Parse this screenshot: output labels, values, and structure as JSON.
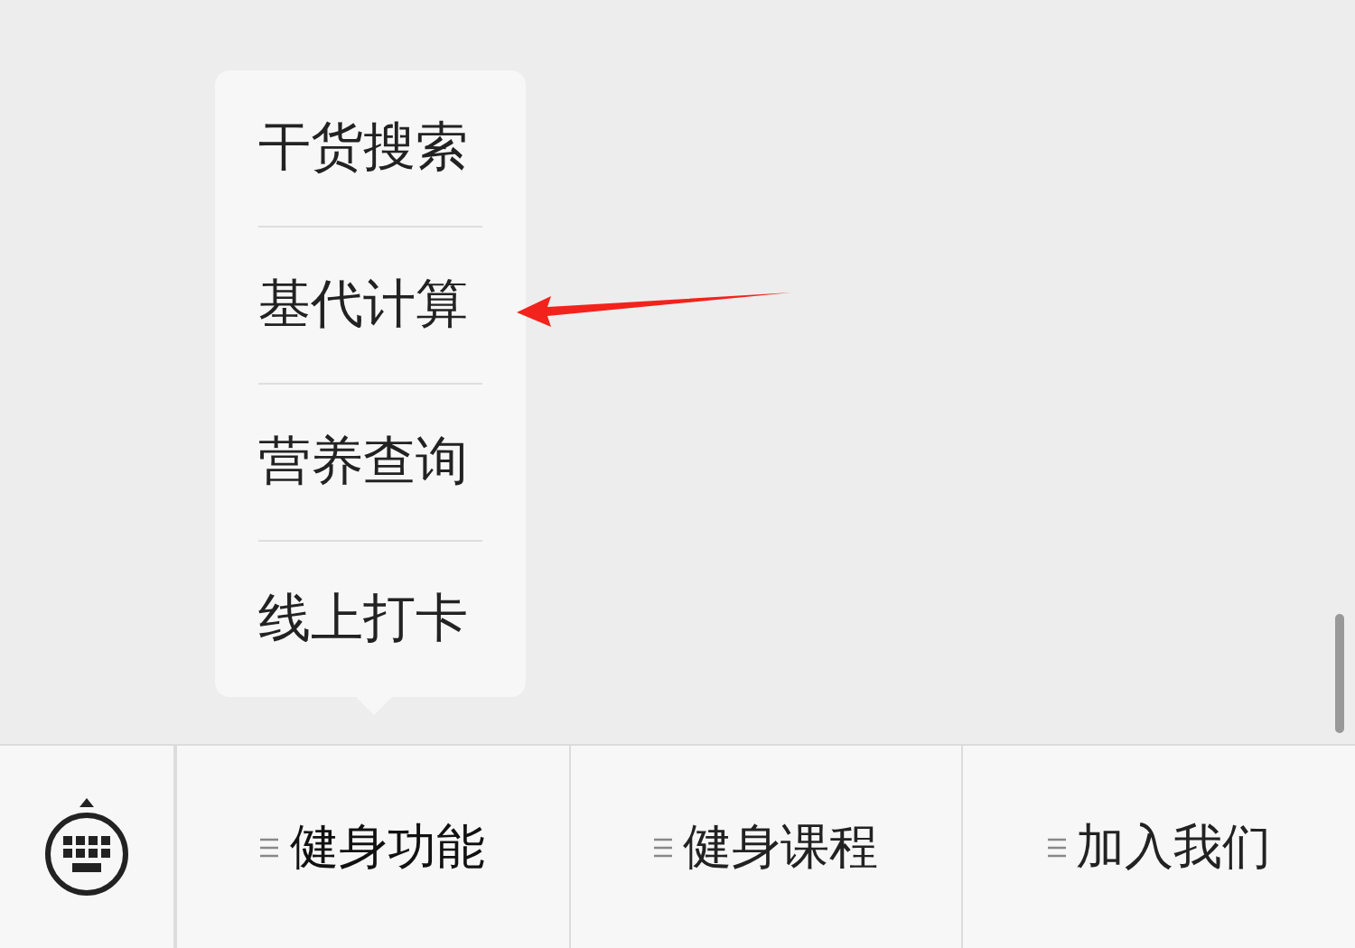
{
  "popup_menu": {
    "items": [
      {
        "label": "干货搜索"
      },
      {
        "label": "基代计算"
      },
      {
        "label": "营养查询"
      },
      {
        "label": "线上打卡"
      }
    ]
  },
  "bottom_menu": {
    "tabs": [
      {
        "label": "健身功能",
        "open": true
      },
      {
        "label": "健身课程",
        "open": false
      },
      {
        "label": "加入我们",
        "open": false
      }
    ]
  }
}
